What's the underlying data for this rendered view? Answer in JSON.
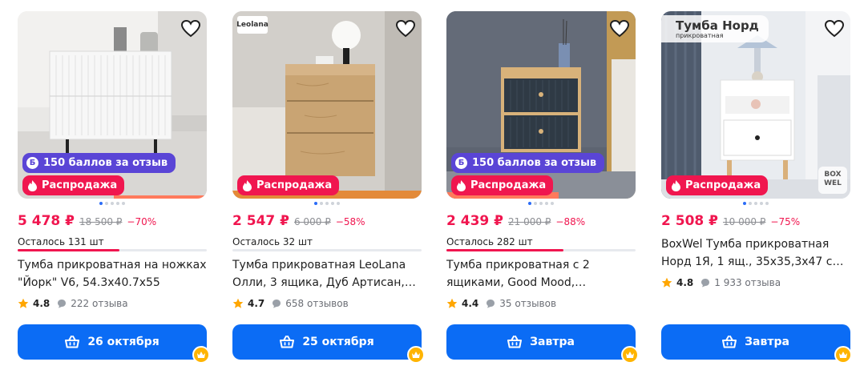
{
  "colors": {
    "accent": "#0b6cf5",
    "sale": "#f0164f",
    "bonus": "#5a45d6",
    "crown": "#ffb400"
  },
  "products": [
    {
      "bonus": "150 баллов за отзыв",
      "sale": "Распродажа",
      "price": "5 478 ₽",
      "old_price": "18 500 ₽",
      "discount": "−70%",
      "stock": "Осталось 131 шт",
      "stock_level": 0.54,
      "title_line1": "Тумба прикроватная на ножках",
      "title_line2": "\"Йорк\" V6, 54.3x40.7x55",
      "rating": "4.8",
      "reviews": "222 отзыва",
      "delivery": "26 октября"
    },
    {
      "brand_logo": "Leolana",
      "sale": "Распродажа",
      "price": "2 547 ₽",
      "old_price": "6 000 ₽",
      "discount": "−58%",
      "stock": "Осталось 32 шт",
      "stock_level": 0.0,
      "title_line1": "Тумба прикроватная LeoLana",
      "title_line2": "Олли, 3 ящика, Дуб Артисан,…",
      "rating": "4.7",
      "reviews": "658 отзывов",
      "delivery": "25 октября"
    },
    {
      "bonus": "150 баллов за отзыв",
      "sale": "Распродажа",
      "price": "2 439 ₽",
      "old_price": "21 000 ₽",
      "discount": "−88%",
      "stock": "Осталось 282 шт",
      "stock_level": 0.62,
      "title_line1": "Тумба прикроватная с 2",
      "title_line2": "ящиками, Good Mood,…",
      "rating": "4.4",
      "reviews": "35 отзывов",
      "delivery": "Завтра"
    },
    {
      "image_title": "Тумба Норд",
      "image_subtitle": "прикроватная",
      "image_brand": "BOX WEL",
      "sale": "Распродажа",
      "price": "2 508 ₽",
      "old_price": "10 000 ₽",
      "discount": "−75%",
      "title_line1": "BoxWel Тумба прикроватная",
      "title_line2": "Норд 1Я, 1 ящ., 35x35,3x47 см, …",
      "rating": "4.8",
      "reviews": "1 933 отзыва",
      "delivery": "Завтра"
    }
  ],
  "icons": {
    "favorite": "heart-outline-icon",
    "cart": "basket-icon",
    "premium": "crown-icon",
    "rating": "star-icon",
    "reviews": "chat-bubble-icon",
    "sale": "flame-icon",
    "bonus": "bonus-b-icon"
  }
}
